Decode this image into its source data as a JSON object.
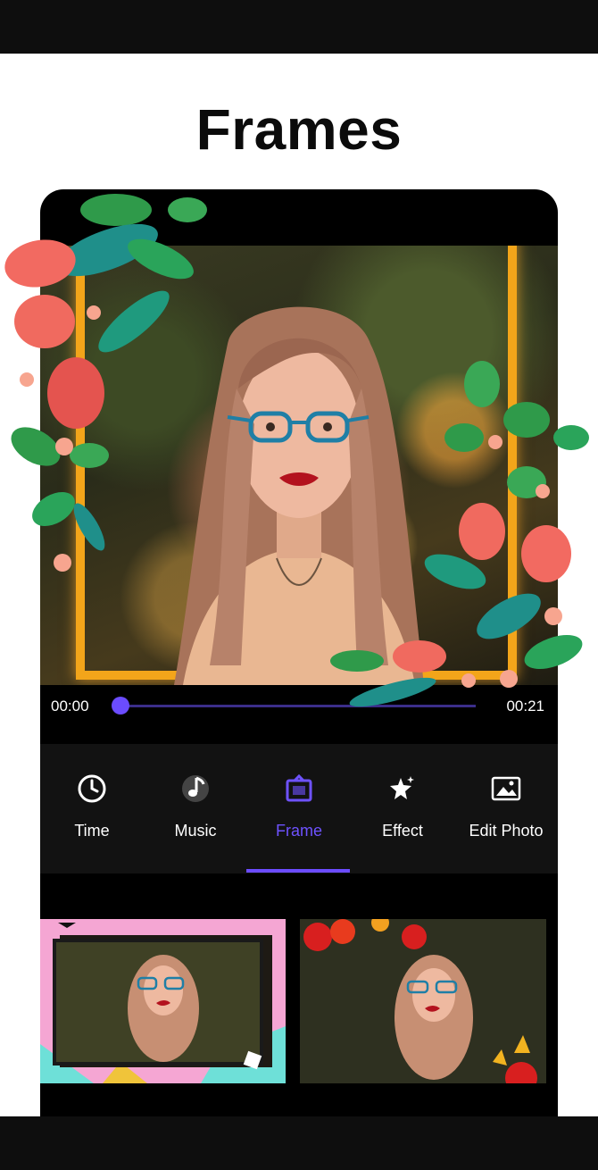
{
  "heading": "Frames",
  "player": {
    "time_start": "00:00",
    "time_end": "00:21",
    "progress": 0.0
  },
  "toolbar": {
    "items": [
      {
        "label": "Time",
        "icon": "clock-icon"
      },
      {
        "label": "Music",
        "icon": "music-note-icon"
      },
      {
        "label": "Frame",
        "icon": "frame-icon",
        "active": true
      },
      {
        "label": "Effect",
        "icon": "sparkle-icon"
      },
      {
        "label": "Edit Photo",
        "icon": "image-icon"
      }
    ]
  },
  "colors": {
    "accent": "#6b4cff",
    "frame_gold": "#f3a51a",
    "toolbar_bg": "#121212"
  }
}
